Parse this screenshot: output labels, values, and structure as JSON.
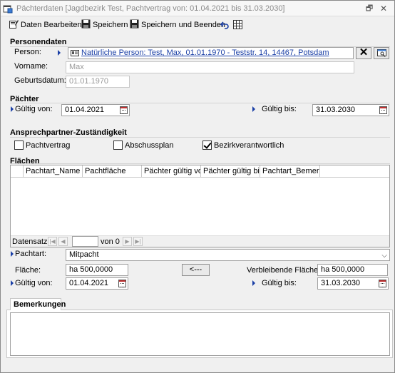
{
  "window": {
    "title": "Pächterdaten [Jagdbezirk Test, Pachtvertrag von: 01.04.2021 bis 31.03.2030]"
  },
  "toolbar": {
    "edit_label": "Daten Bearbeiten",
    "save_label": "Speichern",
    "save_close_label": "Speichern und Beenden"
  },
  "person_section": {
    "heading": "Personendaten",
    "person_label": "Person:",
    "person_value": "Natürliche Person: Test, Max, 01.01.1970 - Teststr. 14, 14467, Potsdam",
    "firstname_label": "Vorname:",
    "firstname_value": "Max",
    "birthdate_label": "Geburtsdatum:",
    "birthdate_value": "01.01.1970"
  },
  "tenant_section": {
    "heading": "Pächter",
    "valid_from_label": "Gültig von:",
    "valid_from_value": "01.04.2021",
    "valid_to_label": "Gültig bis:",
    "valid_to_value": "31.03.2030"
  },
  "contact_section": {
    "heading": "Ansprechpartner-Zuständigkeit",
    "checkboxes": [
      {
        "label": "Pachtvertrag",
        "checked": false
      },
      {
        "label": "Abschussplan",
        "checked": false
      },
      {
        "label": "Bezirkverantwortlich",
        "checked": true
      }
    ]
  },
  "areas_section": {
    "heading": "Flächen",
    "columns": [
      "Pachtart_Name",
      "Pachtfläche",
      "Pächter gültig von",
      "Pächter gültig bis",
      "Pachtart_Bemerk..."
    ],
    "rows": [],
    "record_label": "Datensatz:",
    "record_current": "",
    "record_total": "von 0",
    "lease_type_label": "Pachtart:",
    "lease_type_value": "Mitpacht",
    "area_label": "Fläche:",
    "area_value": "ha 500,0000",
    "assign_button": "<---",
    "remaining_label": "Verbleibende Fläche:",
    "remaining_value": "ha 500,0000",
    "valid_from_label": "Gültig von:",
    "valid_from_value": "01.04.2021",
    "valid_to_label": "Gültig bis:",
    "valid_to_value": "31.03.2030"
  },
  "remarks": {
    "tab_label": "Bemerkungen",
    "value": ""
  },
  "colors": {
    "link": "#1a3fa6",
    "required_marker": "#1a3fa6",
    "readonly_text": "#9a9a9a"
  }
}
